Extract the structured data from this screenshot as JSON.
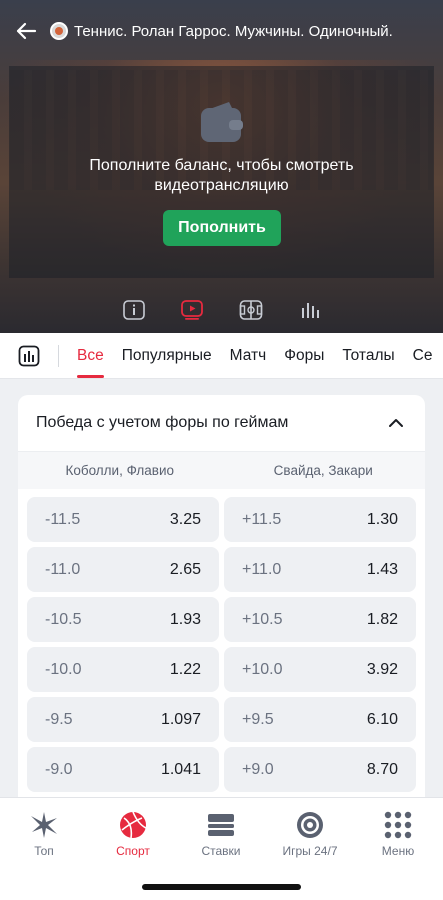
{
  "header": {
    "title": "Теннис. Ролан Гаррос. Мужчины. Одиночный..."
  },
  "video": {
    "message": "Пополните баланс, чтобы смотреть видеотрансляцию",
    "topup_label": "Пополнить",
    "modes": [
      "info-icon",
      "play-video-icon",
      "court-icon",
      "stats-bars-icon"
    ]
  },
  "tabs": {
    "items": [
      "Все",
      "Популярные",
      "Матч",
      "Форы",
      "Тоталы",
      "Се"
    ],
    "active": "Все"
  },
  "market": {
    "title": "Победа с учетом форы по геймам",
    "team_left": "Коболли, Флавио",
    "team_right": "Свайда, Закари",
    "rows": [
      {
        "lh": "-11.5",
        "lo": "3.25",
        "rh": "+11.5",
        "ro": "1.30"
      },
      {
        "lh": "-11.0",
        "lo": "2.65",
        "rh": "+11.0",
        "ro": "1.43"
      },
      {
        "lh": "-10.5",
        "lo": "1.93",
        "rh": "+10.5",
        "ro": "1.82"
      },
      {
        "lh": "-10.0",
        "lo": "1.22",
        "rh": "+10.0",
        "ro": "3.92"
      },
      {
        "lh": "-9.5",
        "lo": "1.097",
        "rh": "+9.5",
        "ro": "6.10"
      },
      {
        "lh": "-9.0",
        "lo": "1.041",
        "rh": "+9.0",
        "ro": "8.70"
      }
    ]
  },
  "nav": {
    "items": [
      {
        "label": "Топ",
        "icon": "top-star-icon"
      },
      {
        "label": "Спорт",
        "icon": "volleyball-icon"
      },
      {
        "label": "Ставки",
        "icon": "bets-icon"
      },
      {
        "label": "Игры 24/7",
        "icon": "target-icon"
      },
      {
        "label": "Меню",
        "icon": "menu-grid-icon"
      }
    ],
    "active": "Спорт"
  },
  "colors": {
    "accent": "#e62a3f",
    "topup": "#20a35a"
  }
}
